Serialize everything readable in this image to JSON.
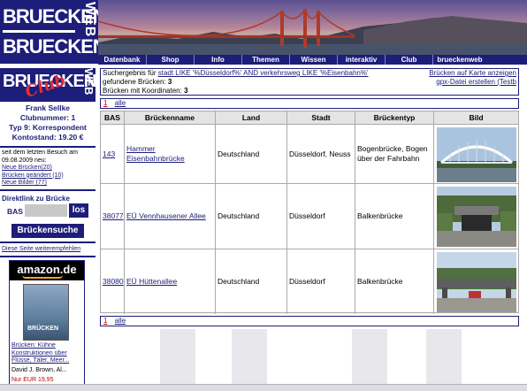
{
  "logo": {
    "line1": "BRUECKEN",
    "line2": "WEB",
    "line3": "BRUECKEN"
  },
  "nav": {
    "tabs": [
      "Datenbank",
      "Shop",
      "Info",
      "Themen",
      "Wissen",
      "interaktiv",
      "Club",
      "brueckenweb"
    ]
  },
  "club_logo": {
    "word1": "BRUECKEN",
    "word2": "Club",
    "word3": "WEB"
  },
  "member": {
    "name": "Frank Sellke",
    "club_number": "Clubnummer: 1",
    "type": "Typ 9: Korrespondent",
    "balance": "Kontostand: 19.20 €"
  },
  "since": {
    "intro": "seit dem letzten Besuch am 09.08.2009 neu:",
    "new_bridges": "Neue Brücken(20)",
    "changed_bridges": "Brücken geändert (10)",
    "new_images": "Neue Bilder (77)"
  },
  "direct": {
    "title": "Direktlink zu Brücke",
    "bas_label": "BAS",
    "go_label": "los"
  },
  "search_button": "Brückensuche",
  "recommend_link": "Diese Seite weiterempfehlen",
  "amazon": {
    "logo": "amazon.de",
    "cover_text": "BRÜCKEN",
    "title": "Brücken: Kühne Konstruktionen über Flüsse, Täler, Meer...",
    "author": "David J. Brown, Al...",
    "price": "Nur EUR 19,95"
  },
  "results": {
    "query_prefix": "Suchergebnis für",
    "query": "stadt LIKE '%Düsseldorf%' AND verkehrsweg LIKE '%Eisenbahn%'",
    "found_label": "gefundene Brücken:",
    "found_count": "3",
    "coords_label": "Brücken mit Koordinaten:",
    "coords_count": "3",
    "map_link": "Brücken auf Karte anzeigen",
    "gpx_link": "gpx-Datei erstellen (Testb"
  },
  "pager": {
    "current": "1",
    "all": "alle"
  },
  "table": {
    "headers": [
      "BAS",
      "Brückenname",
      "Land",
      "Stadt",
      "Brückentyp",
      "Bild"
    ],
    "rows": [
      {
        "bas": "143",
        "name": "Hammer Eisenbahnbrücke",
        "land": "Deutschland",
        "stadt": "Düsseldorf, Neuss",
        "typ": "Bogenbrücke, Bogen über der Fahrbahn",
        "image": "arch-bridge-photo"
      },
      {
        "bas": "38077",
        "name": "EÜ Vennhausener Allee",
        "land": "Deutschland",
        "stadt": "Düsseldorf",
        "typ": "Balkenbrücke",
        "image": "underpass-photo"
      },
      {
        "bas": "38080",
        "name": "EÜ Hüttenallee",
        "land": "Deutschland",
        "stadt": "Düsseldorf",
        "typ": "Balkenbrücke",
        "image": "street-bridge-photo"
      }
    ]
  },
  "colors": {
    "brand": "#1d1d7a",
    "accent_red": "#c00000",
    "header_gray": "#e4e4e4"
  }
}
